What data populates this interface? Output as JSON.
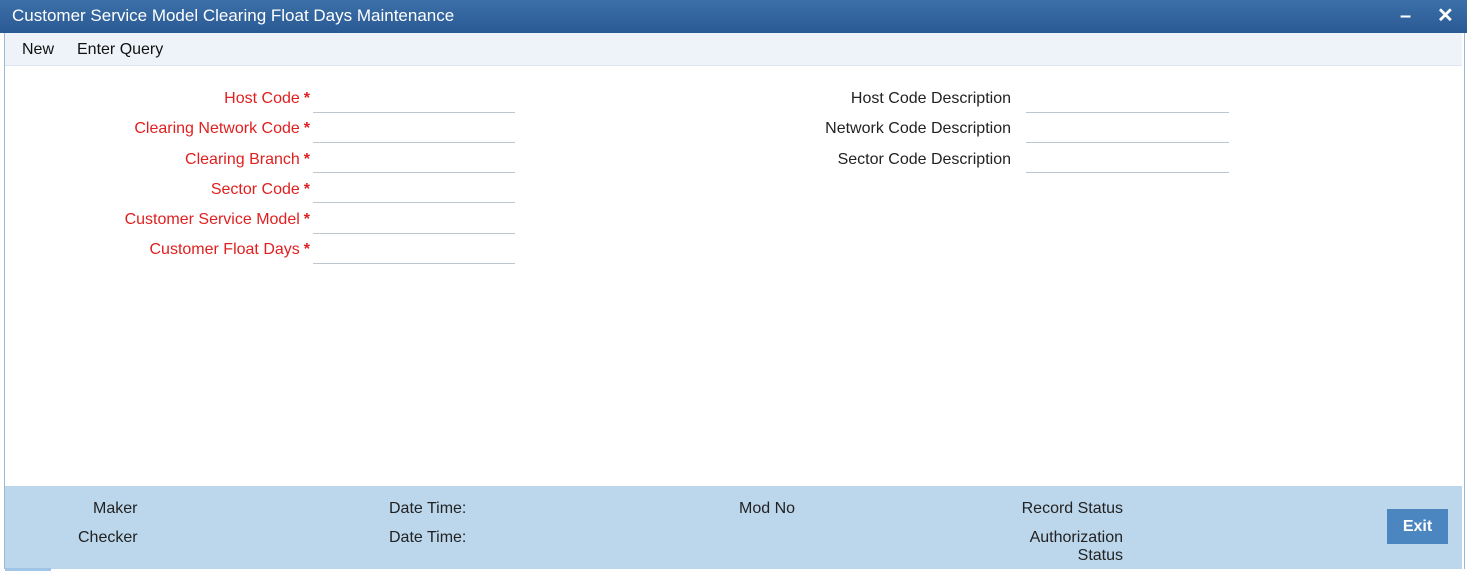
{
  "window": {
    "title": "Customer Service Model Clearing Float Days Maintenance",
    "minimize_glyph": "–",
    "close_glyph": "✕"
  },
  "toolbar": {
    "new_label": "New",
    "enter_query_label": "Enter Query"
  },
  "form_left": [
    {
      "label": "Host Code",
      "value": "",
      "required": true
    },
    {
      "label": "Clearing Network Code",
      "value": "",
      "required": true
    },
    {
      "label": "Clearing Branch",
      "value": "",
      "required": true
    },
    {
      "label": "Sector Code",
      "value": "",
      "required": true
    },
    {
      "label": "Customer Service Model",
      "value": "",
      "required": true
    },
    {
      "label": "Customer Float Days",
      "value": "",
      "required": true
    }
  ],
  "required_marker": "*",
  "form_right": [
    {
      "label": "Host Code Description",
      "value": ""
    },
    {
      "label": "Network Code Description",
      "value": ""
    },
    {
      "label": "Sector Code Description",
      "value": ""
    }
  ],
  "footer": {
    "maker_label": "Maker",
    "checker_label": "Checker",
    "maker_datetime_label": "Date Time:",
    "checker_datetime_label": "Date Time:",
    "mod_no_label": "Mod No",
    "record_status_label": "Record Status",
    "auth_status_line1": "Authorization",
    "auth_status_line2": "Status",
    "exit_label": "Exit"
  },
  "colors": {
    "title_bar": "#2f6199",
    "required_label": "#e02020",
    "footer_bg": "#bcd7ec",
    "exit_button": "#4b86c0"
  }
}
